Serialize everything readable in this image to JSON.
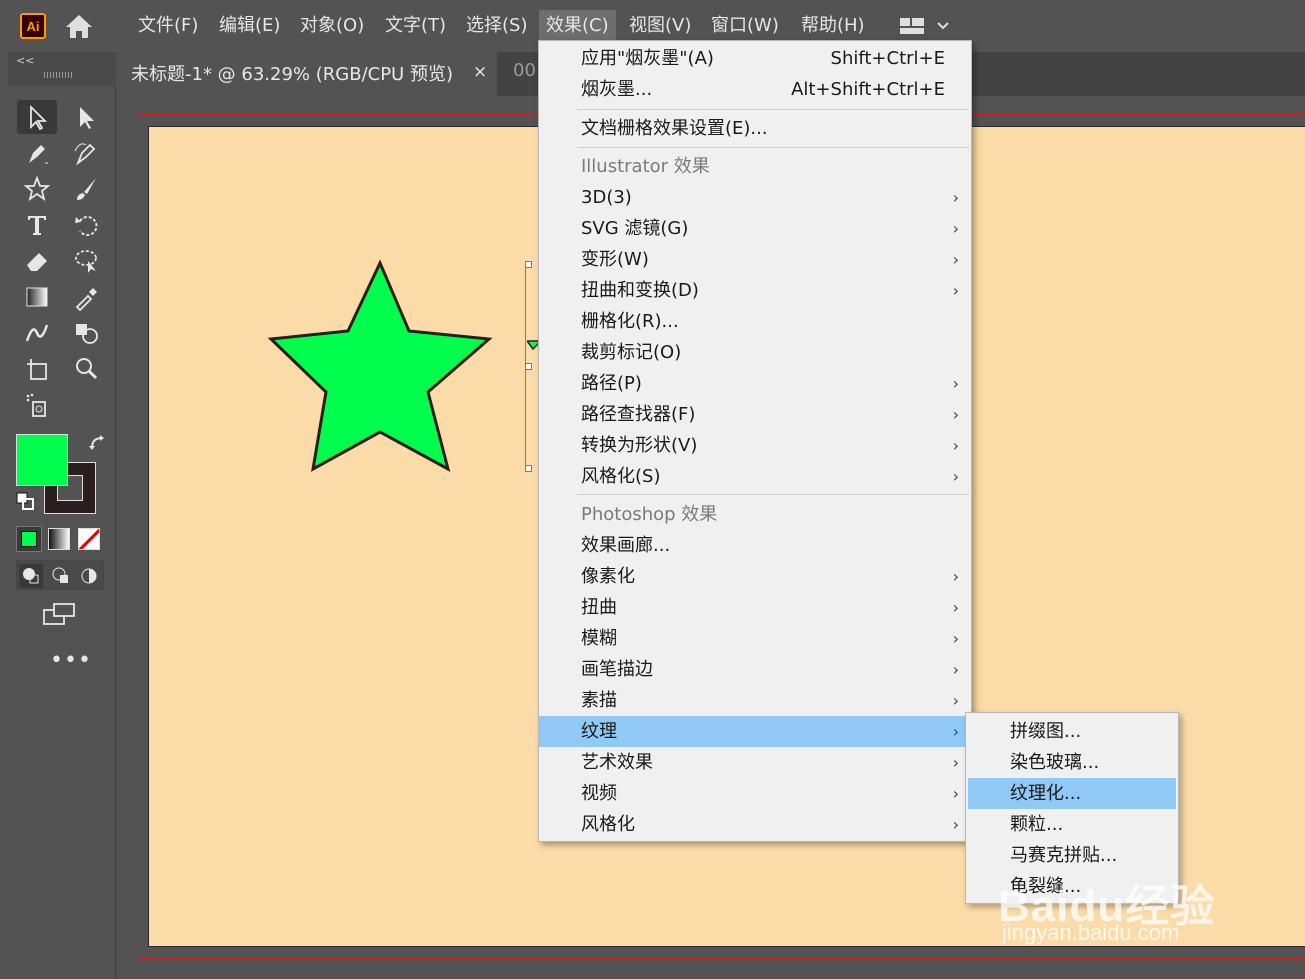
{
  "app": {
    "logo_text": "Ai"
  },
  "menubar": {
    "items": [
      "文件(F)",
      "编辑(E)",
      "对象(O)",
      "文字(T)",
      "选择(S)",
      "效果(C)",
      "视图(V)",
      "窗口(W)",
      "帮助(H)"
    ],
    "active": "效果(C)"
  },
  "toolpanel": {
    "collapse_label": "<<"
  },
  "document": {
    "tab_title": "未标题-1* @ 63.29% (RGB/CPU 预览)",
    "tab_close": "×",
    "second_tab": "00"
  },
  "colors": {
    "fill": "#00ff4c",
    "stroke": "#2a1e1e",
    "artboard": "#fbdca8",
    "menu_highlight": "#90c8f6"
  },
  "effect_menu": {
    "apply_last": {
      "label": "应用\"烟灰墨\"(A)",
      "shortcut": "Shift+Ctrl+E"
    },
    "last_effect": {
      "label": "烟灰墨...",
      "shortcut": "Alt+Shift+Ctrl+E"
    },
    "doc_raster_settings": "文档栅格效果设置(E)...",
    "illustrator_header": "Illustrator 效果",
    "illustrator_items": [
      {
        "label": "3D(3)",
        "submenu": true
      },
      {
        "label": "SVG 滤镜(G)",
        "submenu": true
      },
      {
        "label": "变形(W)",
        "submenu": true
      },
      {
        "label": "扭曲和变换(D)",
        "submenu": true
      },
      {
        "label": "栅格化(R)...",
        "submenu": false
      },
      {
        "label": "裁剪标记(O)",
        "submenu": false
      },
      {
        "label": "路径(P)",
        "submenu": true
      },
      {
        "label": "路径查找器(F)",
        "submenu": true
      },
      {
        "label": "转换为形状(V)",
        "submenu": true
      },
      {
        "label": "风格化(S)",
        "submenu": true
      }
    ],
    "photoshop_header": "Photoshop 效果",
    "photoshop_items": [
      {
        "label": "效果画廊...",
        "submenu": false
      },
      {
        "label": "像素化",
        "submenu": true
      },
      {
        "label": "扭曲",
        "submenu": true
      },
      {
        "label": "模糊",
        "submenu": true
      },
      {
        "label": "画笔描边",
        "submenu": true
      },
      {
        "label": "素描",
        "submenu": true
      },
      {
        "label": "纹理",
        "submenu": true,
        "highlighted": true
      },
      {
        "label": "艺术效果",
        "submenu": true
      },
      {
        "label": "视频",
        "submenu": true
      },
      {
        "label": "风格化",
        "submenu": true
      }
    ],
    "arrow": "›"
  },
  "texture_submenu": {
    "items": [
      {
        "label": "拼缀图..."
      },
      {
        "label": "染色玻璃..."
      },
      {
        "label": "纹理化...",
        "highlighted": true
      },
      {
        "label": "颗粒..."
      },
      {
        "label": "马赛克拼贴..."
      },
      {
        "label": "龟裂缝..."
      }
    ]
  },
  "watermark": {
    "brand": "Baidu经验",
    "url": "jingyan.baidu.com"
  }
}
